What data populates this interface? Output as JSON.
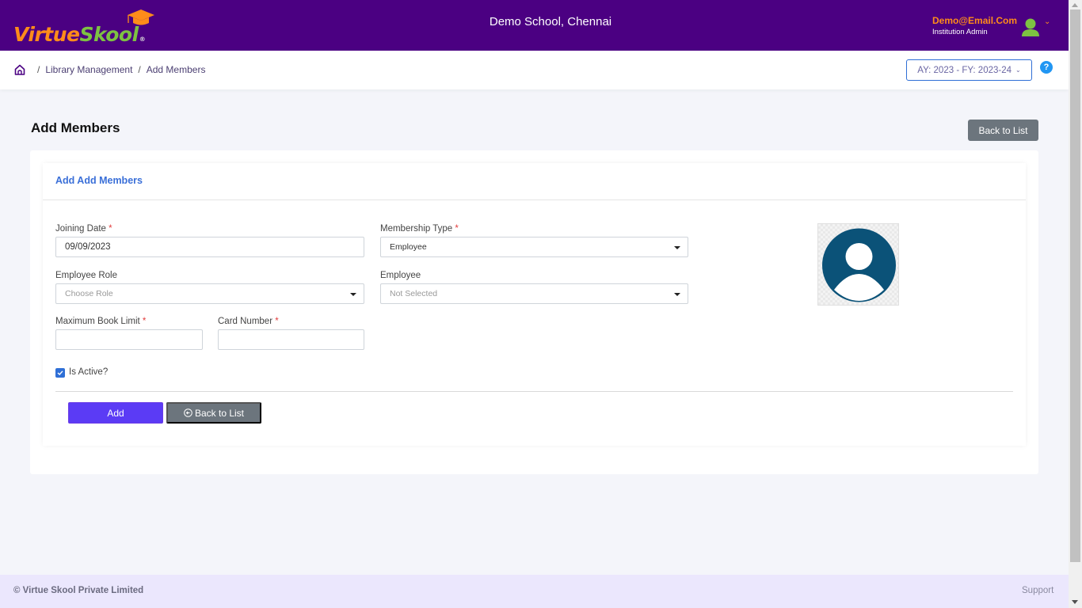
{
  "header": {
    "logo": {
      "part1": "Virtue",
      "part2": "Skool",
      "reg": "®"
    },
    "school_name": "Demo School, Chennai",
    "user": {
      "email": "Demo@Email.Com",
      "role": "Institution Admin"
    },
    "colors": {
      "brand_purple": "#4b0082",
      "accent_orange": "#ff8c1a",
      "accent_green": "#7dc242"
    }
  },
  "breadcrumb": {
    "items": [
      "Library Management",
      "Add Members"
    ],
    "separator": "/"
  },
  "year_selector": {
    "value": "AY: 2023 - FY: 2023-24"
  },
  "help": {
    "label": "?"
  },
  "page": {
    "title": "Add Members",
    "back_to_list_label": "Back to List"
  },
  "form": {
    "card_title": "Add Add Members",
    "fields": {
      "joining_date": {
        "label": "Joining Date",
        "required": "*",
        "value": "09/09/2023"
      },
      "membership_type": {
        "label": "Membership Type",
        "required": "*",
        "value": "Employee"
      },
      "employee_role": {
        "label": "Employee Role",
        "placeholder": "Choose Role"
      },
      "employee": {
        "label": "Employee",
        "placeholder": "Not Selected"
      },
      "max_book_limit": {
        "label": "Maximum Book Limit",
        "required": "*",
        "value": ""
      },
      "card_number": {
        "label": "Card Number",
        "required": "*",
        "value": ""
      }
    },
    "is_active": {
      "label": "Is Active?",
      "checked": true
    },
    "buttons": {
      "add": "Add",
      "back": "Back to List"
    },
    "colors": {
      "add_button": "#5b3bf5",
      "secondary_button": "#6c757d",
      "photo_avatar": "#0b5278"
    }
  },
  "footer": {
    "copyright": "© Virtue Skool Private Limited",
    "support": "Support"
  }
}
